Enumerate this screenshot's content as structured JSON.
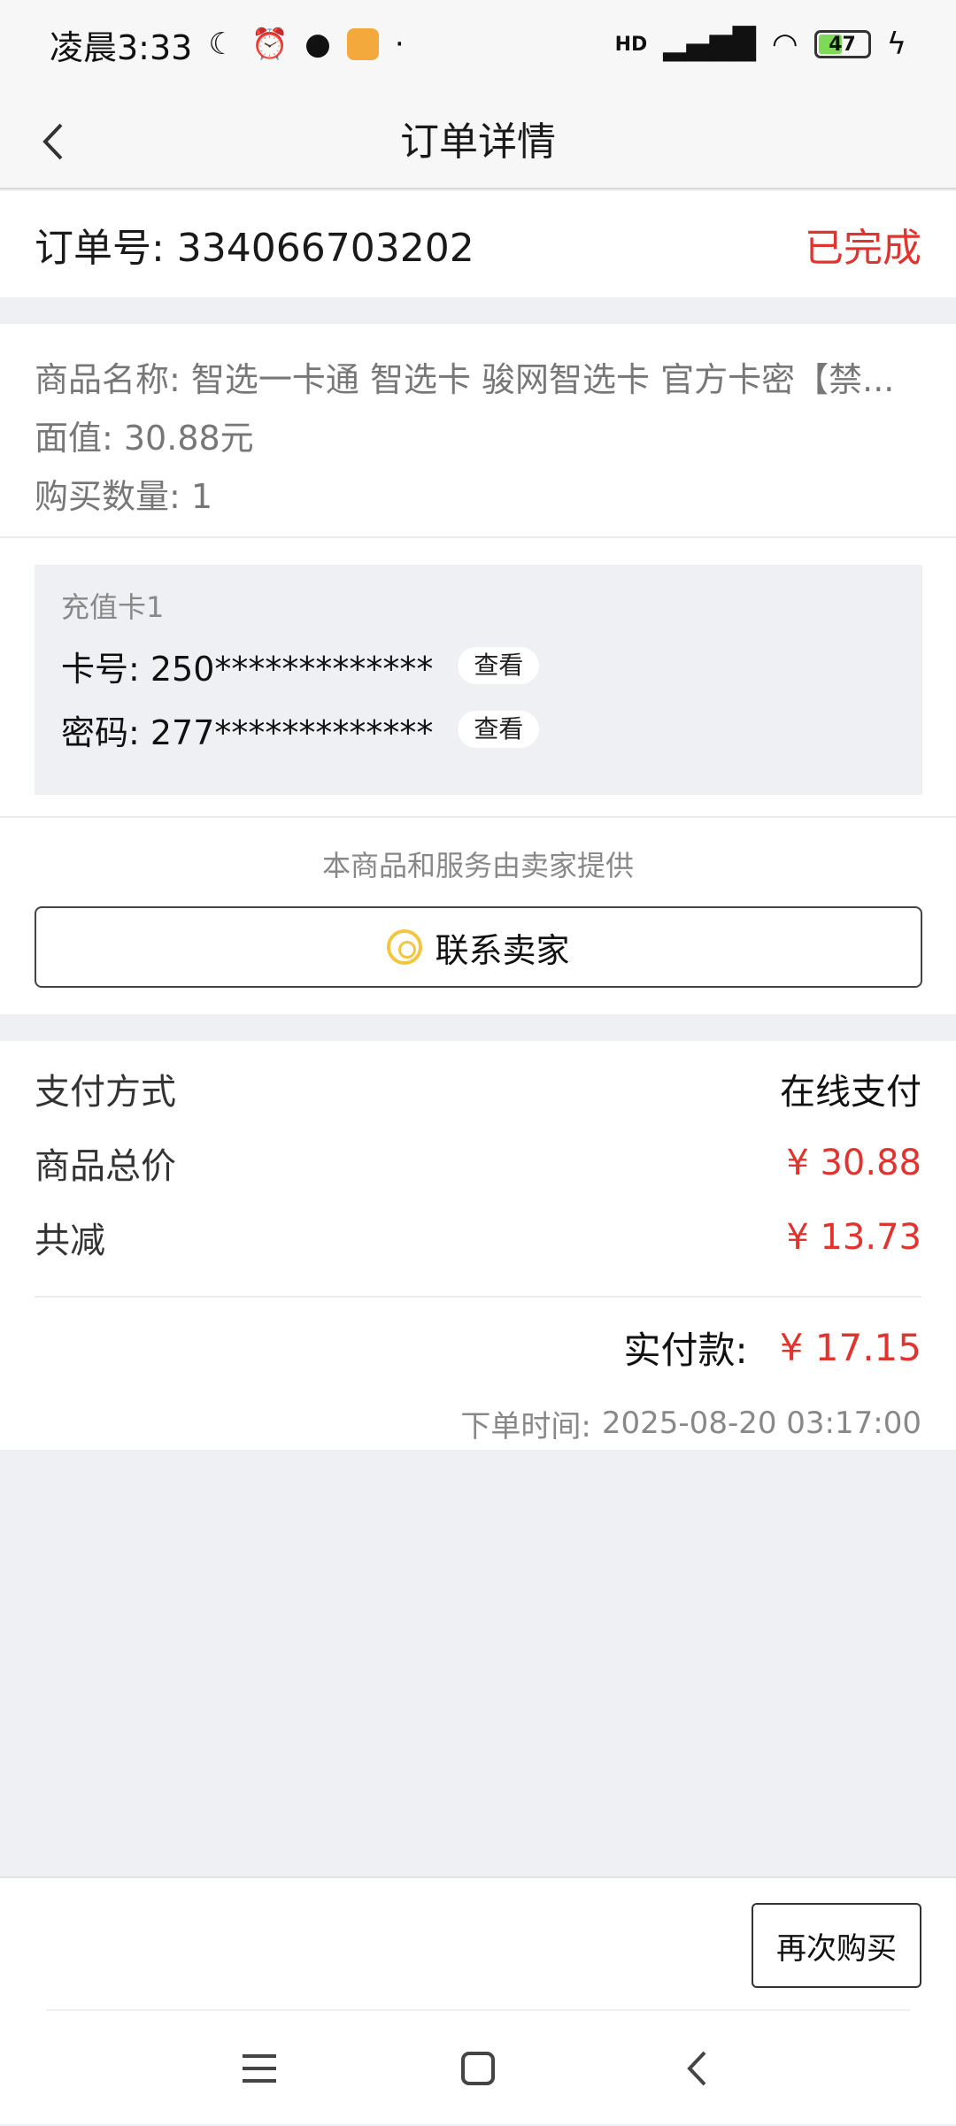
{
  "status_bar": {
    "time": "凌晨3:33",
    "battery": "47",
    "network": "HD"
  },
  "nav": {
    "title": "订单详情"
  },
  "order": {
    "number_label": "订单号: 334066703202",
    "status": "已完成"
  },
  "goods": {
    "name": "商品名称:  智选一卡通 智选卡 骏网智选卡 官方卡密【禁...",
    "face_value": "面值:  30.88元",
    "quantity": "购买数量:  1"
  },
  "recharge": {
    "title": "充值卡1",
    "card_number": "卡号: 250*************",
    "password": "密码: 277*************",
    "view_label": "查看"
  },
  "seller": {
    "note": "本商品和服务由卖家提供",
    "contact_label": "联系卖家"
  },
  "payment": {
    "method_label": "支付方式",
    "method_value": "在线支付",
    "total_label": "商品总价",
    "total_value": "¥ 30.88",
    "discount_label": "共减",
    "discount_value": "¥ 13.73",
    "actual_label": "实付款:",
    "actual_value": "¥ 17.15",
    "time_label": "下单时间:",
    "time_value": "2025-08-20 03:17:00"
  },
  "bottom": {
    "rebuy_label": "再次购买"
  },
  "colors": {
    "accent_red": "#e0342f",
    "background": "#eff0f4"
  }
}
